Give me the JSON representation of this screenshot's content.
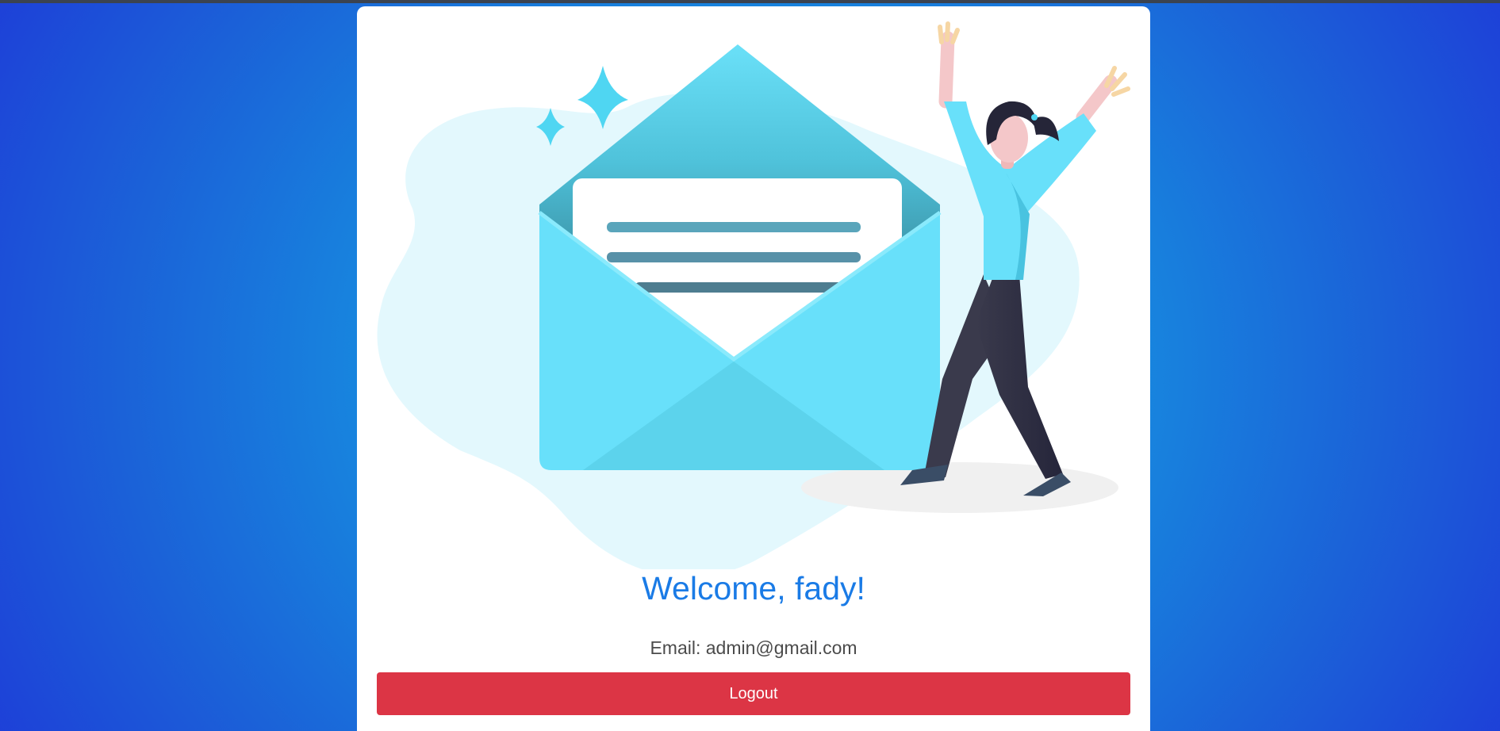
{
  "profile": {
    "welcome": "Welcome, fady!",
    "email_label": "Email:",
    "email_value": "admin@gmail.com"
  },
  "actions": {
    "logout_label": "Logout"
  },
  "colors": {
    "accent": "#1a7be6",
    "danger": "#dc3545",
    "background": "#1690e0"
  },
  "illustration": {
    "icon": "open-envelope-celebration-illustration"
  }
}
